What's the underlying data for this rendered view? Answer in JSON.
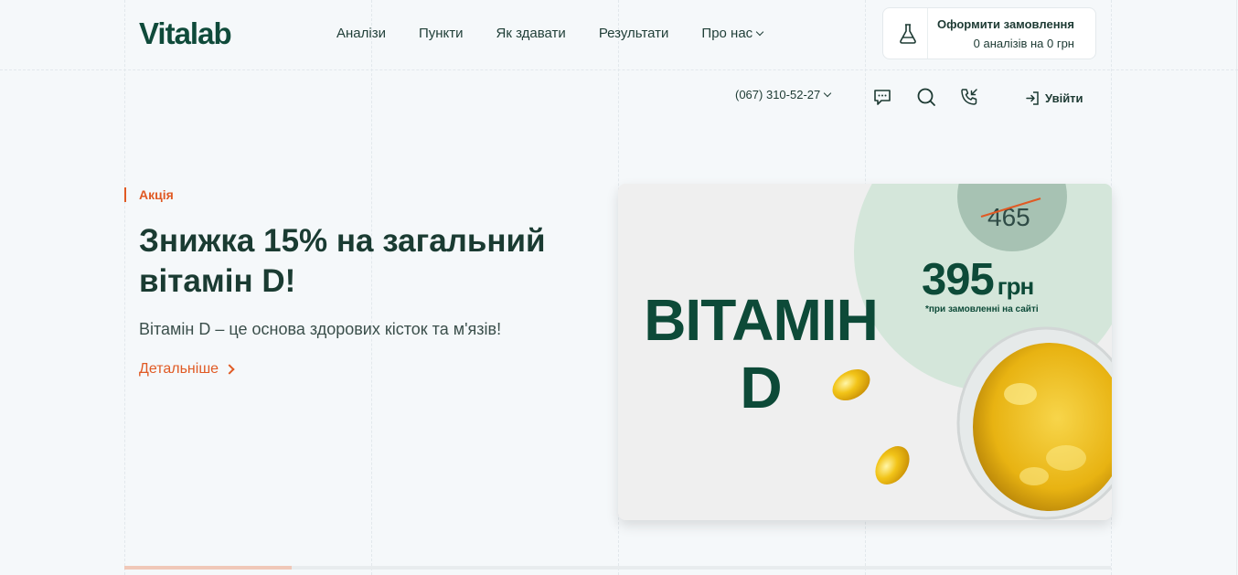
{
  "header": {
    "logo": "Vitalab",
    "nav": [
      {
        "label": "Аналізи"
      },
      {
        "label": "Пункти"
      },
      {
        "label": "Як здавати"
      },
      {
        "label": "Результати"
      },
      {
        "label": "Про нас"
      }
    ],
    "order": {
      "title": "Оформити замовлення",
      "summary": "0 аналізів на 0 грн"
    }
  },
  "utility": {
    "phone": "(067) 310-52-27",
    "icons": [
      "chat-icon",
      "search-icon",
      "callback-icon",
      "login-icon"
    ],
    "login_label": "Увійти"
  },
  "hero": {
    "label": "Акція",
    "title": "Знижка 15% на загальний вітамін D!",
    "subtitle": "Вітамін D – це основа здорових кісток та м'язів!",
    "link": "Детальніше"
  },
  "banner": {
    "title_line1": "ВІТАМІН",
    "title_line2": "D",
    "old_price": "465",
    "new_price": "395",
    "currency": "грн",
    "note": "*при замовленні на сайті"
  },
  "slider": {
    "progress": 0.17
  },
  "colors": {
    "brand": "#0f4a3a",
    "accent": "#e05a24",
    "background": "#f5f8fa"
  }
}
